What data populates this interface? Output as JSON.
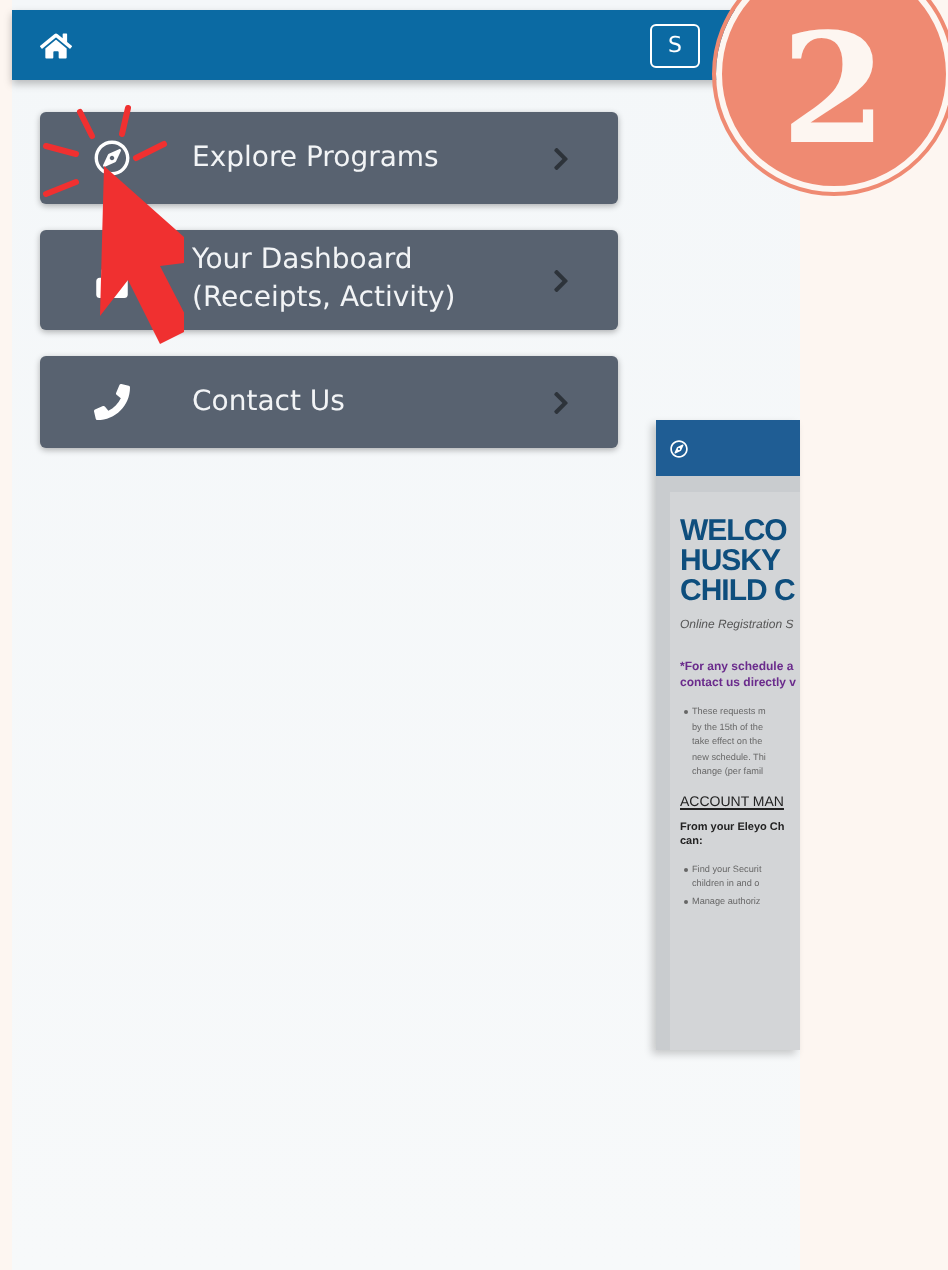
{
  "header": {
    "button_label": "S"
  },
  "badge": {
    "number": "2"
  },
  "menu": [
    {
      "lines": [
        "Explore Programs"
      ]
    },
    {
      "lines": [
        "Your Dashboard",
        "(Receipts, Activity)"
      ]
    },
    {
      "lines": [
        "Contact Us"
      ]
    }
  ],
  "inset": {
    "title_lines": [
      "WELCO",
      "HUSKY",
      "CHILD C"
    ],
    "subtitle": "Online Registration S",
    "notice_lines": [
      "*For any schedule a",
      "contact us directly v"
    ],
    "bullets": [
      [
        "These requests m",
        "by the 15th of the",
        "take effect on the",
        "new schedule. Thi",
        "change (per famil"
      ]
    ],
    "heading": "ACCOUNT MAN",
    "intro_lines": [
      "From your Eleyo Ch",
      "can:"
    ],
    "bullets2": [
      [
        "Find your Securit",
        "children in and o"
      ],
      [
        "Manage authoriz"
      ]
    ]
  }
}
